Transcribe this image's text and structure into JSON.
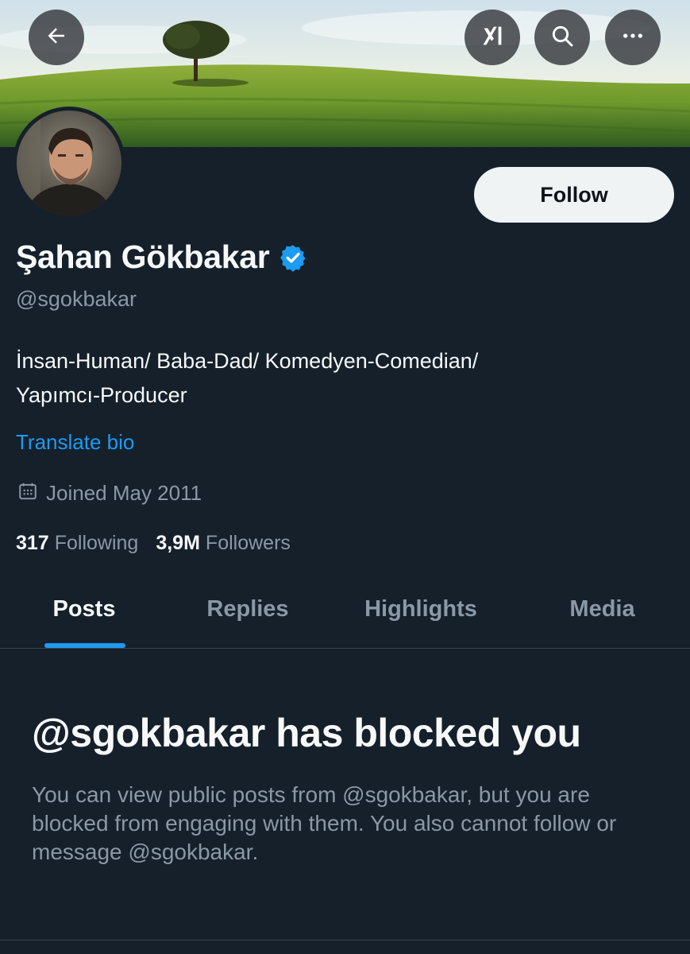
{
  "header": {
    "back_icon": "arrow-left-icon",
    "grok_icon": "grok-icon",
    "search_icon": "search-icon",
    "more_icon": "more-dots-icon"
  },
  "profile": {
    "name": "Şahan Gökbakar",
    "verified": true,
    "handle": "@sgokbakar",
    "bio_line1": "İnsan-Human/ Baba-Dad/ Komedyen-Comedian/",
    "bio_line2": "Yapımcı-Producer",
    "translate_label": "Translate bio",
    "joined": "Joined May 2011",
    "following_count": "317",
    "following_label": "Following",
    "followers_count": "3,9M",
    "followers_label": "Followers",
    "follow_label": "Follow"
  },
  "tabs": [
    {
      "label": "Posts",
      "active": true
    },
    {
      "label": "Replies",
      "active": false
    },
    {
      "label": "Highlights",
      "active": false
    },
    {
      "label": "Media",
      "active": false
    }
  ],
  "blocked": {
    "title": "@sgokbakar has blocked you",
    "body": "You can view public posts from @sgokbakar, but you are blocked from engaging with them. You also cannot follow or message @sgokbakar."
  },
  "colors": {
    "background": "#15202b",
    "accent": "#1d9bf0",
    "text_secondary": "#8b98a5",
    "follow_bg": "#eff3f4"
  }
}
